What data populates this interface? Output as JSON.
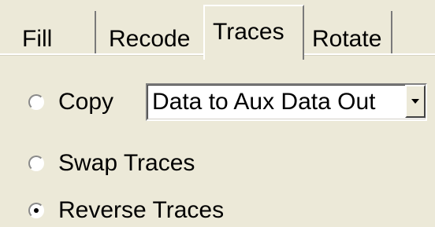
{
  "tabs": [
    {
      "label": "Fill",
      "active": false
    },
    {
      "label": "Recode",
      "active": false
    },
    {
      "label": "Traces",
      "active": true
    },
    {
      "label": "Rotate",
      "active": false
    }
  ],
  "options": {
    "copy": {
      "label": "Copy",
      "selected": false
    },
    "swap": {
      "label": "Swap Traces",
      "selected": false
    },
    "reverse": {
      "label": "Reverse Traces",
      "selected": true
    }
  },
  "copy_dropdown": {
    "value": "Data to Aux Data Out"
  },
  "icons": {
    "radio": "radio-button-icon",
    "dropdown": "chevron-down-icon"
  },
  "colors": {
    "panel": "#ece9d8",
    "highlight": "#ffffff",
    "shadow": "#7a7a7a"
  }
}
